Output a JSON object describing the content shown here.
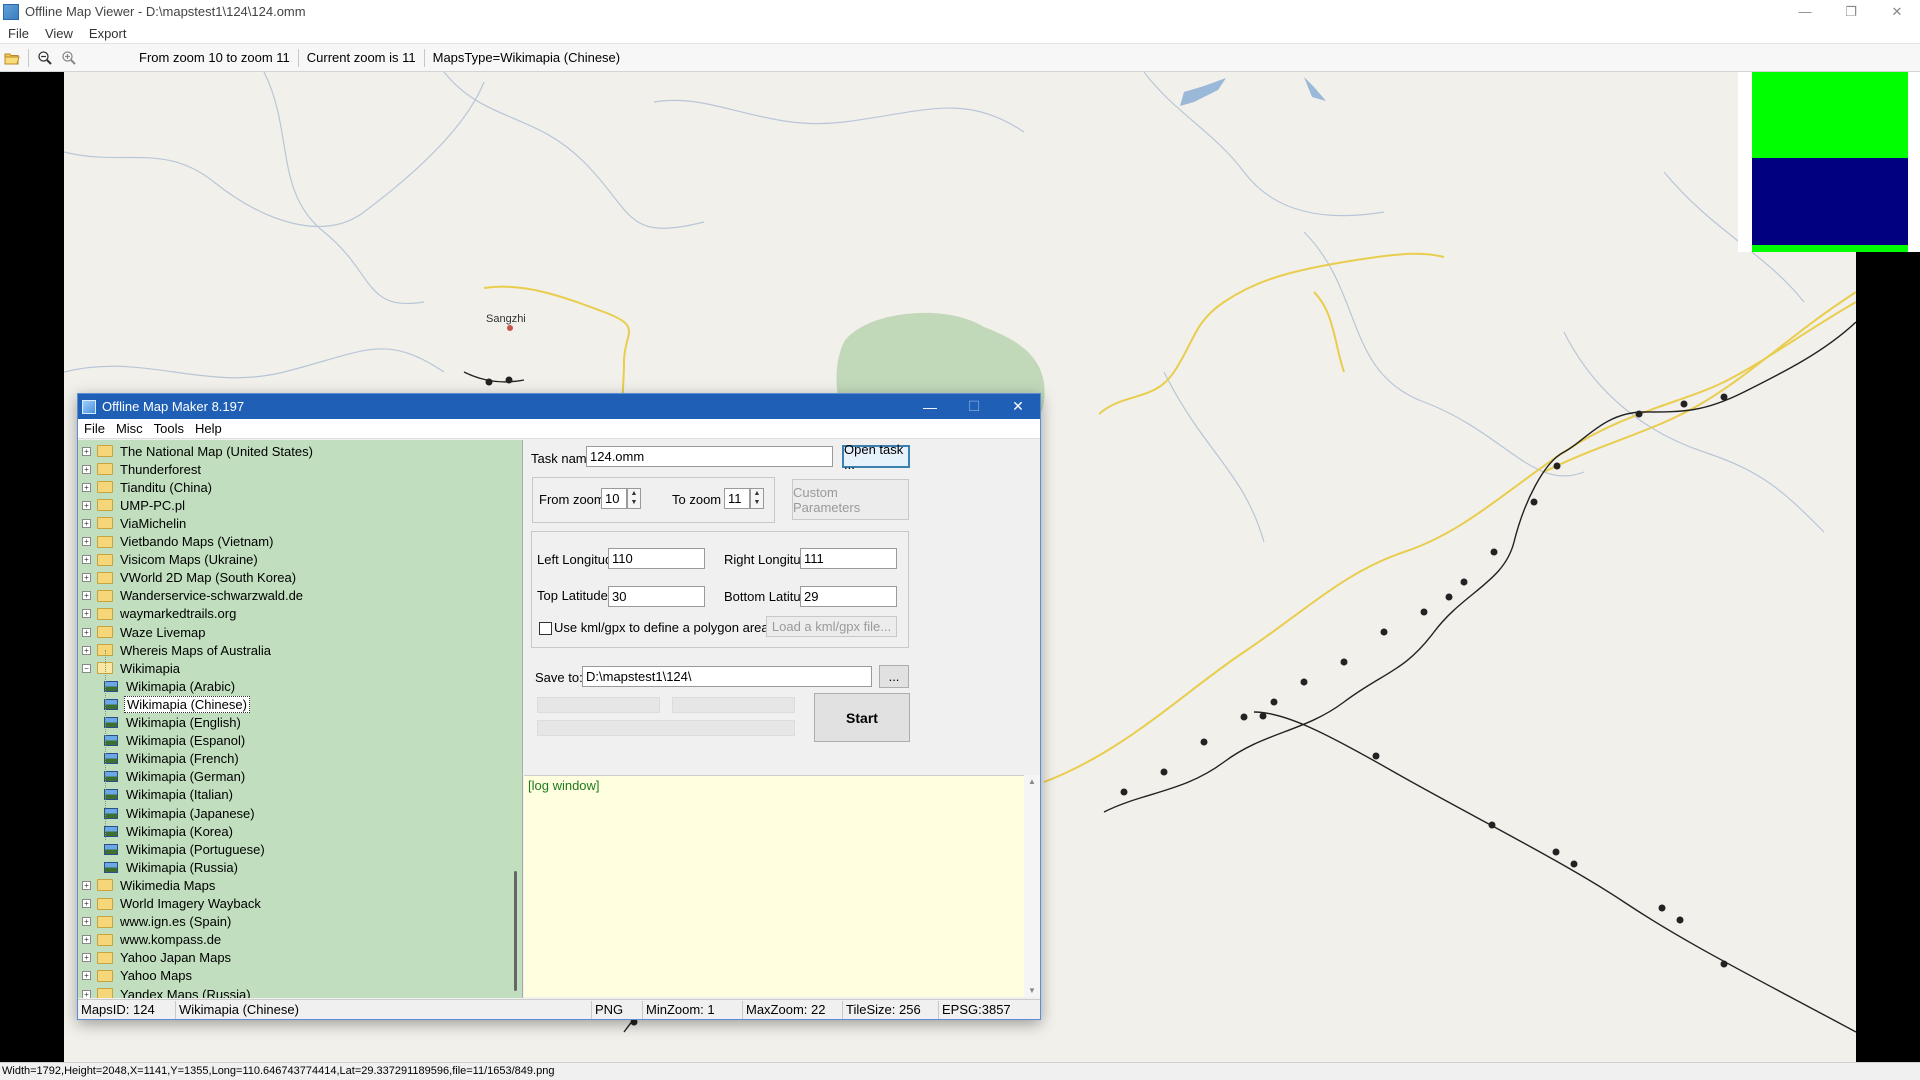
{
  "window": {
    "title": "Offline Map Viewer - D:\\mapstest1\\124\\124.omm",
    "minimize_glyph": "—",
    "restore_glyph": "❐",
    "close_glyph": "✕"
  },
  "menubar": {
    "items": [
      "File",
      "View",
      "Export"
    ]
  },
  "toolbar": {
    "zoom_range": "From zoom 10 to zoom 11",
    "current_zoom": "Current zoom is 11",
    "maps_type": "MapsType=Wikimapia (Chinese)"
  },
  "map": {
    "place_label": "Sangzhi",
    "colors": {
      "land": "#f2f0ea",
      "road_yellow": "#e8cd4e",
      "river": "#9ab8d8",
      "track": "#222222",
      "green_area": "#b9d3b0"
    }
  },
  "overview": {
    "colors": {
      "green": "#00ff00",
      "blue": "#000080"
    }
  },
  "statusbar": {
    "text": "Width=1792,Height=2048,X=1141,Y=1355,Long=110.646743774414,Lat=29.337291189596,file=11/1653/849.png"
  },
  "dialog": {
    "title": "Offline Map Maker 8.197",
    "menu": [
      "File",
      "Misc",
      "Tools",
      "Help"
    ],
    "tree": {
      "items": [
        {
          "label": "The National Map (United States)",
          "type": "folder"
        },
        {
          "label": "Thunderforest",
          "type": "folder"
        },
        {
          "label": "Tianditu (China)",
          "type": "folder"
        },
        {
          "label": "UMP-PC.pl",
          "type": "folder"
        },
        {
          "label": "ViaMichelin",
          "type": "folder"
        },
        {
          "label": "Vietbando Maps (Vietnam)",
          "type": "folder"
        },
        {
          "label": "Visicom Maps (Ukraine)",
          "type": "folder"
        },
        {
          "label": "VWorld 2D Map (South Korea)",
          "type": "folder"
        },
        {
          "label": "Wanderservice-schwarzwald.de",
          "type": "folder"
        },
        {
          "label": "waymarkedtrails.org",
          "type": "folder"
        },
        {
          "label": "Waze Livemap",
          "type": "folder"
        },
        {
          "label": "Whereis Maps of Australia",
          "type": "folder"
        },
        {
          "label": "Wikimapia",
          "type": "folder-open"
        },
        {
          "label": "Wikimapia (Arabic)",
          "type": "map"
        },
        {
          "label": "Wikimapia (Chinese)",
          "type": "map",
          "selected": true
        },
        {
          "label": "Wikimapia (English)",
          "type": "map"
        },
        {
          "label": "Wikimapia (Espanol)",
          "type": "map"
        },
        {
          "label": "Wikimapia (French)",
          "type": "map"
        },
        {
          "label": "Wikimapia (German)",
          "type": "map"
        },
        {
          "label": "Wikimapia (Italian)",
          "type": "map"
        },
        {
          "label": "Wikimapia (Japanese)",
          "type": "map"
        },
        {
          "label": "Wikimapia (Korea)",
          "type": "map"
        },
        {
          "label": "Wikimapia (Portuguese)",
          "type": "map"
        },
        {
          "label": "Wikimapia (Russia)",
          "type": "map"
        },
        {
          "label": "Wikimedia Maps",
          "type": "folder"
        },
        {
          "label": "World Imagery Wayback",
          "type": "folder"
        },
        {
          "label": "www.ign.es (Spain)",
          "type": "folder"
        },
        {
          "label": "www.kompass.de",
          "type": "folder"
        },
        {
          "label": "Yahoo Japan Maps",
          "type": "folder"
        },
        {
          "label": "Yahoo Maps",
          "type": "folder"
        },
        {
          "label": "Yandex Maps (Russia)",
          "type": "folder"
        }
      ]
    },
    "form": {
      "task_name_label": "Task name",
      "task_name_value": "124.omm",
      "open_task_label": "Open task ...",
      "from_zoom_label": "From zoom",
      "from_zoom_value": "10",
      "to_zoom_label": "To zoom",
      "to_zoom_value": "11",
      "custom_params_label": "Custom Parameters",
      "left_lon_label": "Left Longitude",
      "left_lon_value": "110",
      "right_lon_label": "Right Longitude",
      "right_lon_value": "111",
      "top_lat_label": "Top Latitude",
      "top_lat_value": "30",
      "bottom_lat_label": "Bottom Latitude",
      "bottom_lat_value": "29",
      "kml_checkbox_label": "Use kml/gpx to define a polygon area",
      "load_kml_label": "Load a kml/gpx file...",
      "save_to_label": "Save to:",
      "save_to_value": "D:\\mapstest1\\124\\",
      "browse_label": "...",
      "start_label": "Start"
    },
    "log": {
      "text": "[log window]"
    },
    "status": {
      "maps_id": "MapsID: 124",
      "maps_name": "Wikimapia (Chinese)",
      "format": "PNG",
      "min_zoom": "MinZoom: 1",
      "max_zoom": "MaxZoom: 22",
      "tile_size": "TileSize: 256",
      "epsg": "EPSG:3857"
    }
  }
}
